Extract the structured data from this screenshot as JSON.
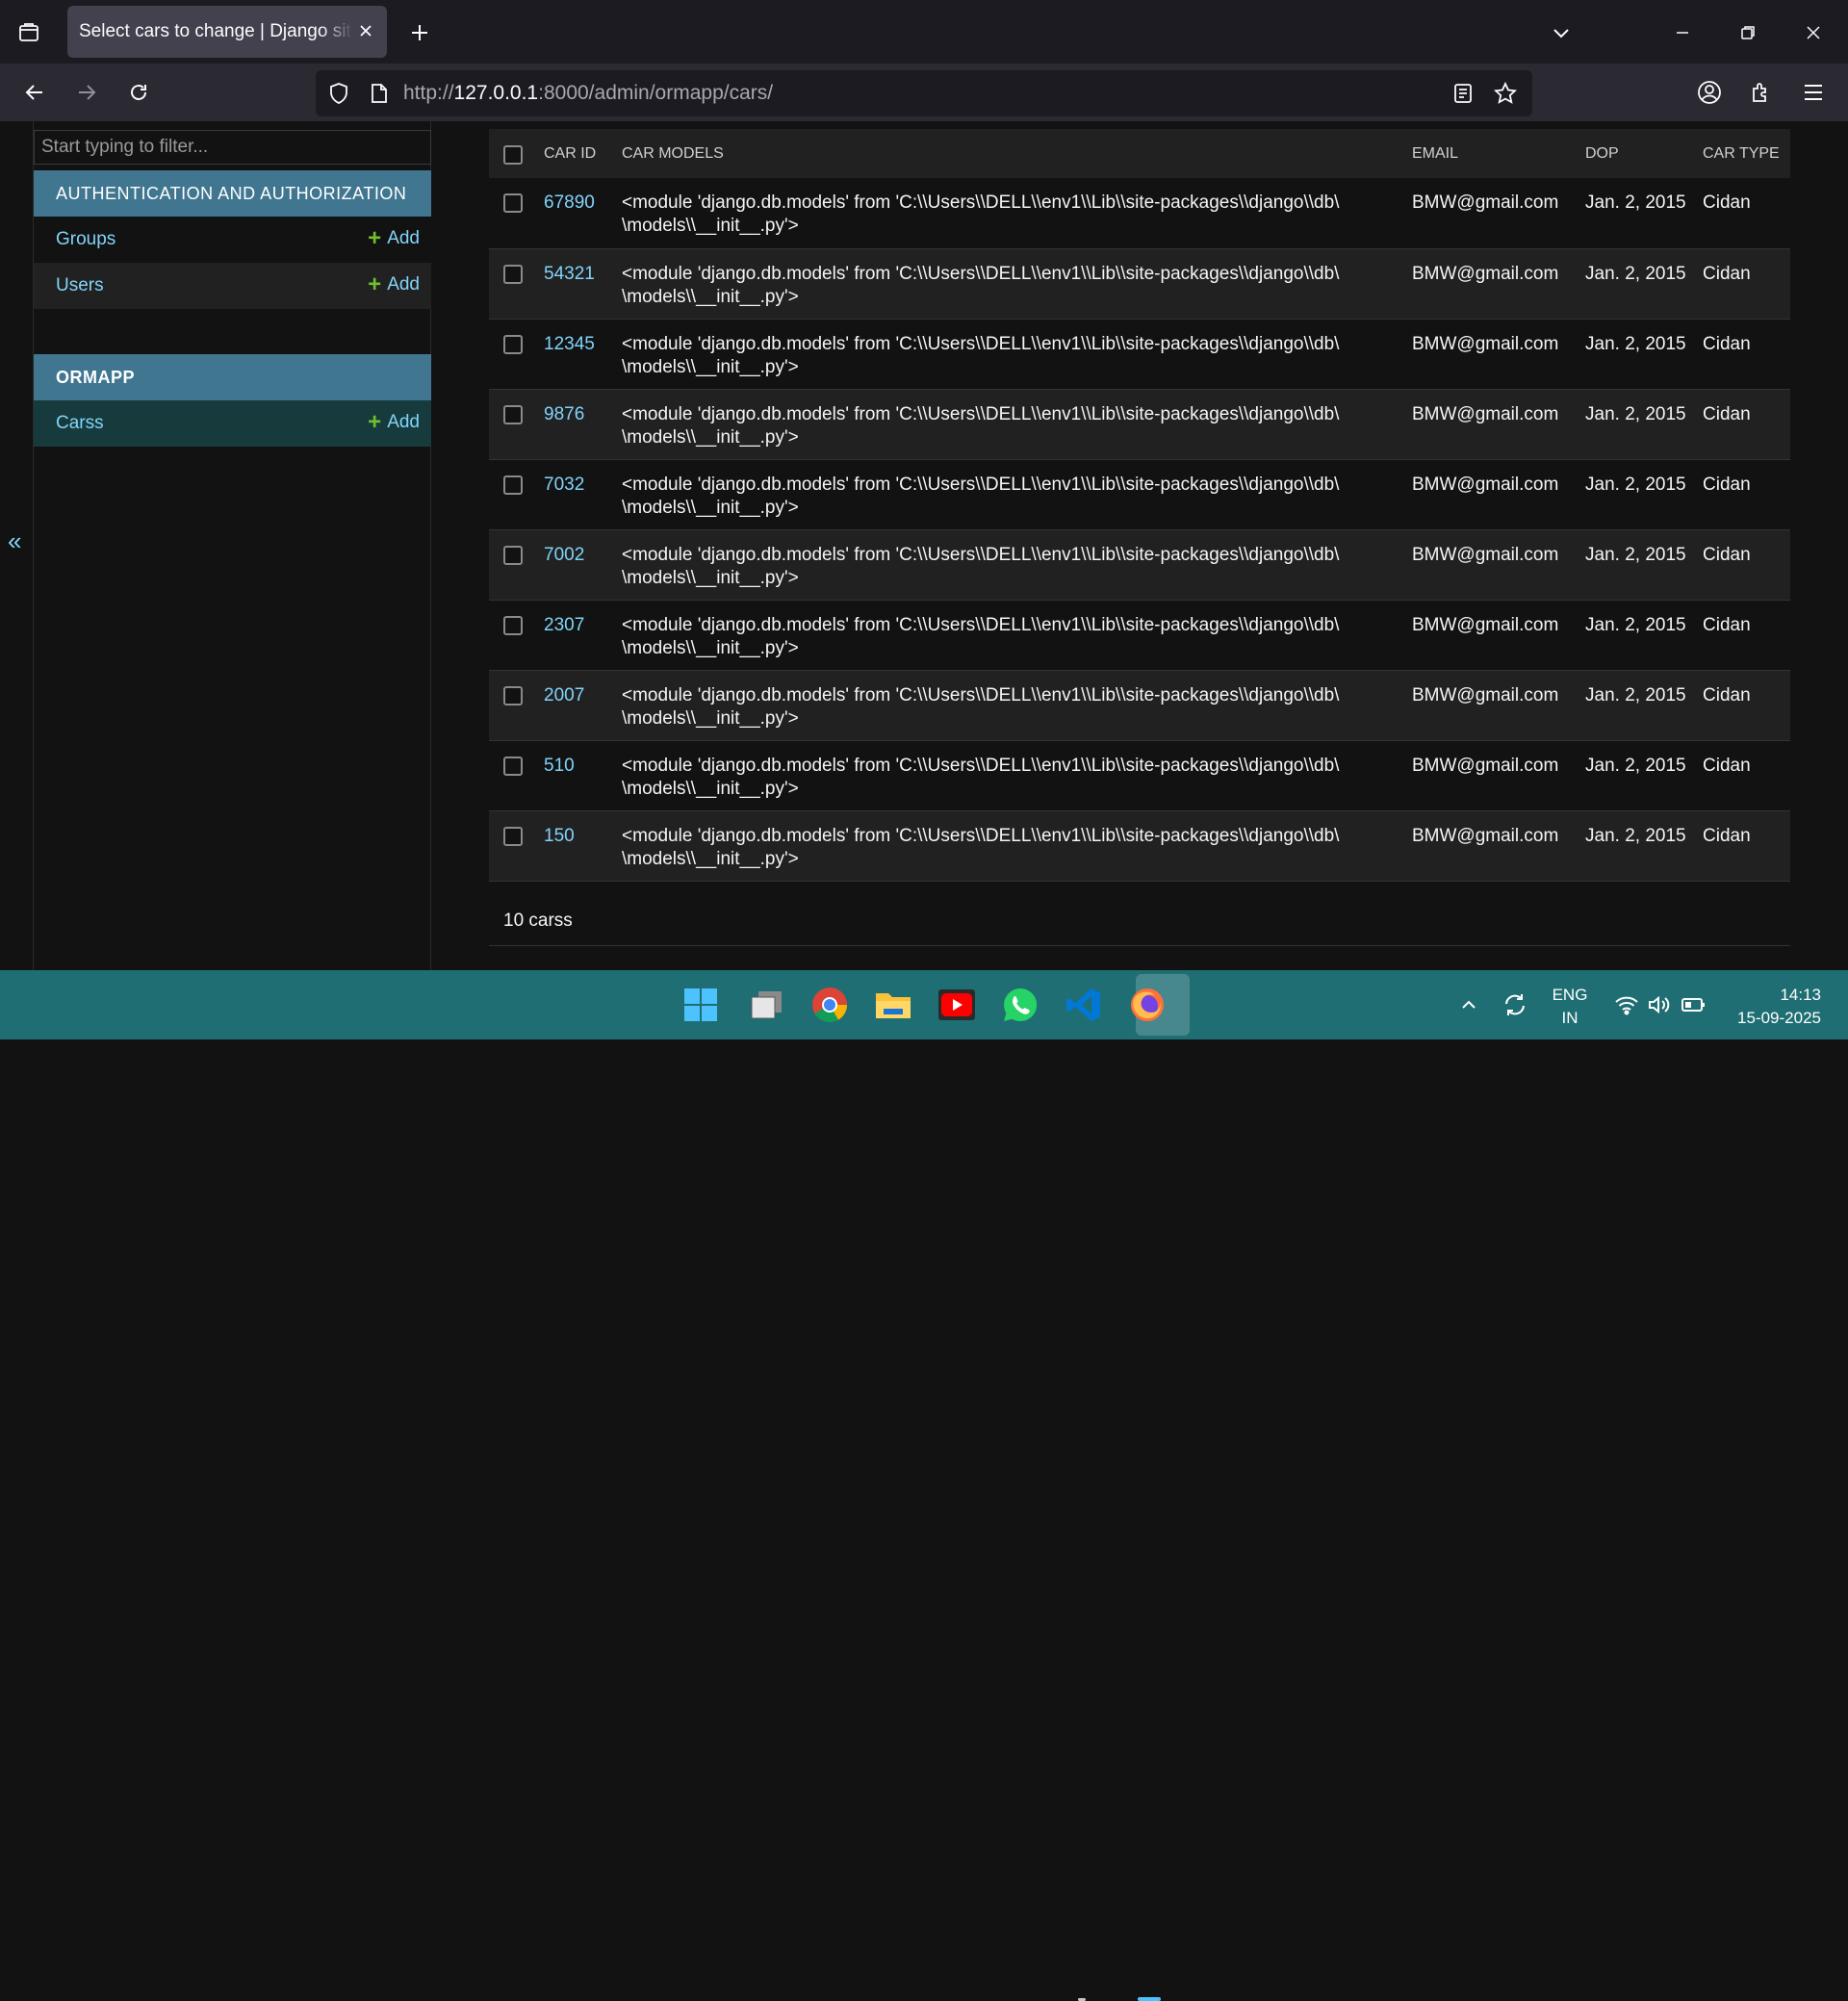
{
  "browser": {
    "tab_title": "Select cars to change | Django site admin",
    "url_prefix": "http://",
    "url_host": "127.0.0.1",
    "url_rest": ":8000/admin/ormapp/cars/"
  },
  "sidebar": {
    "filter_placeholder": "Start typing to filter...",
    "apps": [
      {
        "name": "AUTHENTICATION AND AUTHORIZATION",
        "models": [
          {
            "name": "Groups",
            "add": "Add"
          },
          {
            "name": "Users",
            "add": "Add"
          }
        ]
      },
      {
        "name": "ORMAPP",
        "models": [
          {
            "name": "Carss",
            "add": "Add"
          }
        ]
      }
    ],
    "collapse_glyph": "«"
  },
  "table": {
    "columns": [
      "CAR ID",
      "CAR MODELS",
      "EMAIL",
      "DOP",
      "CAR TYPE"
    ],
    "rows": [
      {
        "id": "67890",
        "model_line1": "<module 'django.db.models' from 'C:\\\\Users\\\\DELL\\\\env1\\\\Lib\\\\site-packages\\\\django\\\\db\\",
        "model_line2": "\\models\\\\__init__.py'>",
        "email": "BMW@gmail.com",
        "dop": "Jan. 2, 2015",
        "type": "Cidan"
      },
      {
        "id": "54321",
        "model_line1": "<module 'django.db.models' from 'C:\\\\Users\\\\DELL\\\\env1\\\\Lib\\\\site-packages\\\\django\\\\db\\",
        "model_line2": "\\models\\\\__init__.py'>",
        "email": "BMW@gmail.com",
        "dop": "Jan. 2, 2015",
        "type": "Cidan"
      },
      {
        "id": "12345",
        "model_line1": "<module 'django.db.models' from 'C:\\\\Users\\\\DELL\\\\env1\\\\Lib\\\\site-packages\\\\django\\\\db\\",
        "model_line2": "\\models\\\\__init__.py'>",
        "email": "BMW@gmail.com",
        "dop": "Jan. 2, 2015",
        "type": "Cidan"
      },
      {
        "id": "9876",
        "model_line1": "<module 'django.db.models' from 'C:\\\\Users\\\\DELL\\\\env1\\\\Lib\\\\site-packages\\\\django\\\\db\\",
        "model_line2": "\\models\\\\__init__.py'>",
        "email": "BMW@gmail.com",
        "dop": "Jan. 2, 2015",
        "type": "Cidan"
      },
      {
        "id": "7032",
        "model_line1": "<module 'django.db.models' from 'C:\\\\Users\\\\DELL\\\\env1\\\\Lib\\\\site-packages\\\\django\\\\db\\",
        "model_line2": "\\models\\\\__init__.py'>",
        "email": "BMW@gmail.com",
        "dop": "Jan. 2, 2015",
        "type": "Cidan"
      },
      {
        "id": "7002",
        "model_line1": "<module 'django.db.models' from 'C:\\\\Users\\\\DELL\\\\env1\\\\Lib\\\\site-packages\\\\django\\\\db\\",
        "model_line2": "\\models\\\\__init__.py'>",
        "email": "BMW@gmail.com",
        "dop": "Jan. 2, 2015",
        "type": "Cidan"
      },
      {
        "id": "2307",
        "model_line1": "<module 'django.db.models' from 'C:\\\\Users\\\\DELL\\\\env1\\\\Lib\\\\site-packages\\\\django\\\\db\\",
        "model_line2": "\\models\\\\__init__.py'>",
        "email": "BMW@gmail.com",
        "dop": "Jan. 2, 2015",
        "type": "Cidan"
      },
      {
        "id": "2007",
        "model_line1": "<module 'django.db.models' from 'C:\\\\Users\\\\DELL\\\\env1\\\\Lib\\\\site-packages\\\\django\\\\db\\",
        "model_line2": "\\models\\\\__init__.py'>",
        "email": "BMW@gmail.com",
        "dop": "Jan. 2, 2015",
        "type": "Cidan"
      },
      {
        "id": "510",
        "model_line1": "<module 'django.db.models' from 'C:\\\\Users\\\\DELL\\\\env1\\\\Lib\\\\site-packages\\\\django\\\\db\\",
        "model_line2": "\\models\\\\__init__.py'>",
        "email": "BMW@gmail.com",
        "dop": "Jan. 2, 2015",
        "type": "Cidan"
      },
      {
        "id": "150",
        "model_line1": "<module 'django.db.models' from 'C:\\\\Users\\\\DELL\\\\env1\\\\Lib\\\\site-packages\\\\django\\\\db\\",
        "model_line2": "\\models\\\\__init__.py'>",
        "email": "BMW@gmail.com",
        "dop": "Jan. 2, 2015",
        "type": "Cidan"
      }
    ],
    "counter": "10 carss"
  },
  "taskbar": {
    "language_line1": "ENG",
    "language_line2": "IN",
    "time": "14:13",
    "date": "15-09-2025",
    "apps": [
      "windows-start",
      "task-view",
      "chrome",
      "file-explorer",
      "youtube",
      "whatsapp",
      "vscode",
      "firefox"
    ]
  },
  "colors": {
    "accent_header": "#417690",
    "link": "#81d4fa",
    "add_plus": "#70bf2b",
    "taskbar": "#1f6e73"
  }
}
